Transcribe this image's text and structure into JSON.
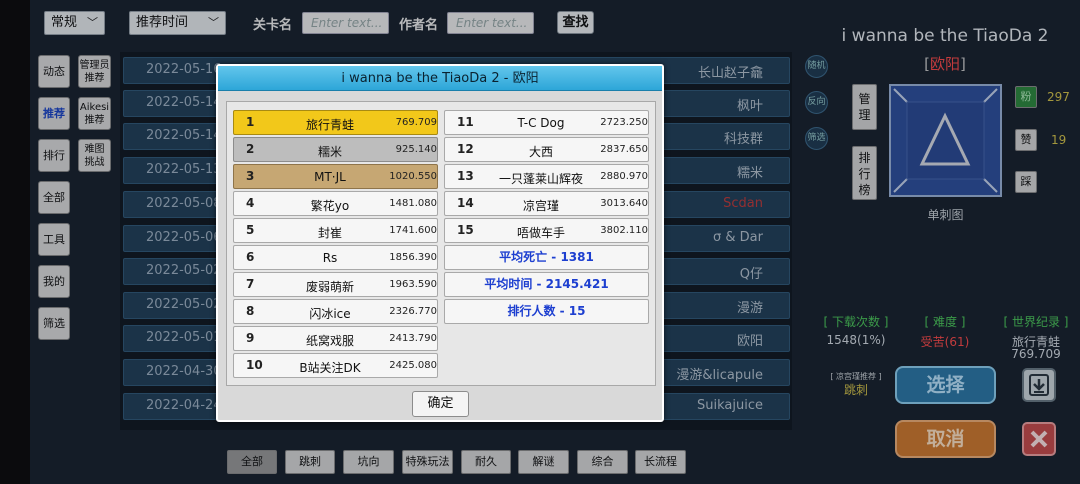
{
  "filters": {
    "category": "常规",
    "sort": "推荐时间",
    "level_label": "关卡名",
    "level_placeholder": "Enter text...",
    "author_label": "作者名",
    "author_placeholder": "Enter text...",
    "find": "查找"
  },
  "nav": {
    "left": [
      "动态",
      "推荐",
      "排行",
      "全部",
      "工具",
      "我的",
      "筛选"
    ],
    "right": [
      [
        "管理员",
        "推荐"
      ],
      [
        "Aikesi",
        "推荐"
      ],
      [
        "难图",
        "挑战"
      ]
    ]
  },
  "levels": [
    {
      "date": "2022-05-16",
      "author": "长山赵子龕"
    },
    {
      "date": "2022-05-14",
      "author": "枫叶"
    },
    {
      "date": "2022-05-14",
      "author": "科技群"
    },
    {
      "date": "2022-05-13",
      "author": "糯米"
    },
    {
      "date": "2022-05-08",
      "author": "Scdan"
    },
    {
      "date": "2022-05-06",
      "author": "σ & Dar"
    },
    {
      "date": "2022-05-02",
      "author": "Q仔"
    },
    {
      "date": "2022-05-02",
      "author": "漫游"
    },
    {
      "date": "2022-05-01",
      "author": "欧阳"
    },
    {
      "date": "2022-04-30",
      "author": "漫游&licapule"
    },
    {
      "date": "2022-04-24",
      "author": "Suikajuice"
    }
  ],
  "side_buttons": [
    "随机",
    "反向",
    "筛选"
  ],
  "tags": [
    "全部",
    "跳刺",
    "坑向",
    "特殊玩法",
    "耐久",
    "解谜",
    "综合",
    "长流程"
  ],
  "detail": {
    "title": "i wanna be the TiaoDa 2",
    "author": "欧阳",
    "manage": "管理",
    "ranking": "排行榜",
    "like_label": "赞",
    "fan_label": "粉",
    "dislike_label": "踩",
    "fan_count": "297",
    "like_count": "19",
    "thumb_caption": "单刺图",
    "downloads_label": "[ 下载次数 ]",
    "downloads_value": "1548(1%)",
    "difficulty_label": "[ 难度 ]",
    "difficulty_value": "受苦(61)",
    "record_label": "[ 世界纪录 ]",
    "record_holder": "旅行青蛙",
    "record_time": "769.709",
    "recommend_note": "[ 凉宫瑾推荐 ]",
    "recommend_value": "跳刺",
    "select": "选择",
    "cancel": "取消",
    "colors": {
      "author": "#ff4a4a",
      "select": "#2b79a8",
      "cancel": "#d17a2e"
    }
  },
  "modal": {
    "title": "i wanna be the TiaoDa 2 - 欧阳",
    "ranks": [
      {
        "rank": "1",
        "name": "旅行青蛙",
        "time": "769.709"
      },
      {
        "rank": "2",
        "name": "糯米",
        "time": "925.140"
      },
      {
        "rank": "3",
        "name": "MT·JL",
        "time": "1020.550"
      },
      {
        "rank": "4",
        "name": "繁花yo",
        "time": "1481.080"
      },
      {
        "rank": "5",
        "name": "封崔",
        "time": "1741.600"
      },
      {
        "rank": "6",
        "name": "Rs",
        "time": "1856.390"
      },
      {
        "rank": "7",
        "name": "废弱萌新",
        "time": "1963.590"
      },
      {
        "rank": "8",
        "name": "闪冰ice",
        "time": "2326.770"
      },
      {
        "rank": "9",
        "name": "纸窝戏服",
        "time": "2413.790"
      },
      {
        "rank": "10",
        "name": "B站关注DK",
        "time": "2425.080"
      },
      {
        "rank": "11",
        "name": "T-C Dog",
        "time": "2723.250"
      },
      {
        "rank": "12",
        "name": "大西",
        "time": "2837.650"
      },
      {
        "rank": "13",
        "name": "一只蓬莱山辉夜",
        "time": "2880.970"
      },
      {
        "rank": "14",
        "name": "凉宫瑾",
        "time": "3013.640"
      },
      {
        "rank": "15",
        "name": "唔做车手",
        "time": "3802.110"
      }
    ],
    "avg_death": "平均死亡 - 1381",
    "avg_time": "平均时间 - 2145.421",
    "count": "排行人数 - 15",
    "ok": "确定"
  }
}
